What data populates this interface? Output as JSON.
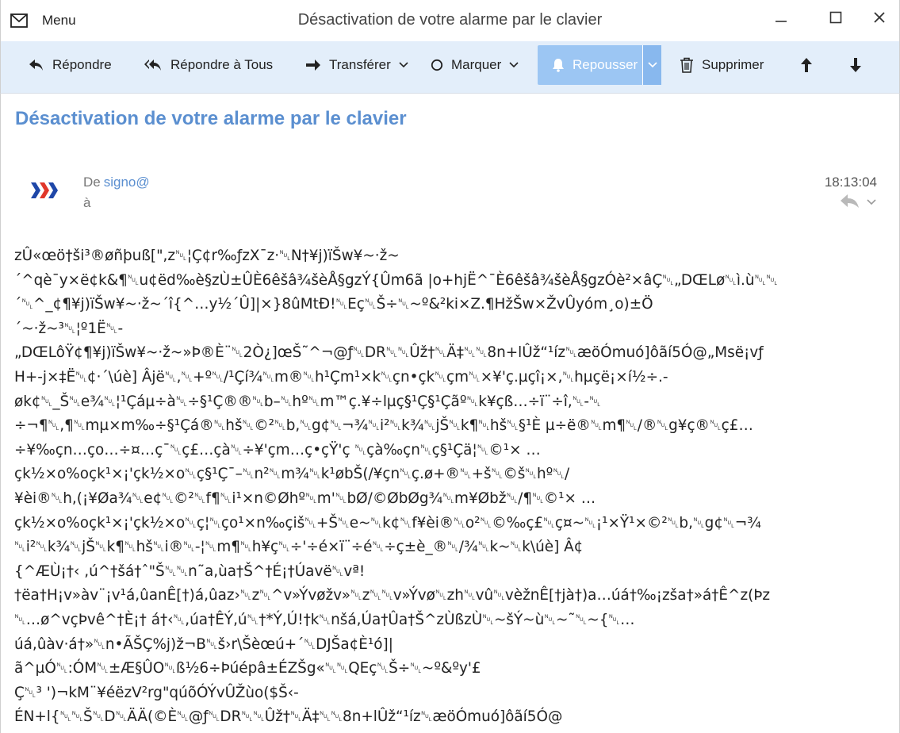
{
  "window": {
    "menu_label": "Menu",
    "title": "Désactivation de votre alarme par le clavier",
    "controls": [
      "minimize-icon",
      "maximize-icon",
      "close-icon"
    ]
  },
  "toolbar": {
    "reply": "Répondre",
    "reply_all": "Répondre à Tous",
    "forward": "Transférer",
    "mark": "Marquer",
    "snooze": "Repousser",
    "delete": "Supprimer",
    "accent": "#9cc6f3"
  },
  "message": {
    "subject": "Désactivation de votre alarme par le clavier",
    "from_label": "De",
    "from": "signo@",
    "to_label": "à",
    "time": "18:13:04",
    "subject_color": "#5b8fd0",
    "body_lines": [
      "zÛ«œö†ši³®øñþuß[\",z␀¦Ç¢r‰ƒzX¯z·␀N†¥j)ïŠw¥~·ž~",
      "´^qè¯y×ë¢k&¶␀u¢ëd‰è§zÙ±ÛÈ6êšâ¾šèÅ§gzÝ{Ûm6ã  |o+hjË^¯È6êšâ¾šèÅ§gzÓè²×âÇ␀„DŒLø␀ì.ù␀␀",
      "´␀^_¢¶¥j)ïŠw¥~·ž~´î{^…y½´Û]|×}8ûMtÐ!␀Eç␀Š÷␀~º&²ki×Z.¶HžŠw×ŽvÛyóm¸o)±Ö",
      "´~·ž~³␀¦º1Ë␀-",
      "„DŒLôŸ¢¶¥j)ïŠw¥~·ž~»Þ®È¨␀2Ò¿]œŠ˜^¬@ƒ␀DR␀␀Ûž†␀Ä‡␀␀8n+lÛž“¹íz␀æöÓmuó]ôãí5Ó@„Msë¡vƒ",
      "H+-j×‡Ë␀¢·´\\úè] Âjë␀,␀+º␀/¹Çí¾␀m®␀h¹Çm¹×k␀çn•çk␀çm␀×¥'ç.µçî¡×,␀hµçë¡×í½÷.-",
      "øk¢␀_Š␀e¾␀¦¹Çáµ÷à␀÷§¹Ç®®␀b–␀hº␀m™ç.¥÷lµç§¹Ç§¹Çãº␀k¥çß…÷ï¨÷î,␀-␀",
      "÷¬¶␀,¶␀mµ×m‰÷§¹Çá®␀hš␀©²␀b,␀g¢␀¬¾␀i²␀k¾␀jŠ␀k¶␀hš␀§¹È µ÷ë®␀m¶␀/®␀g¥ç®␀ç£…",
      "÷¥‰çn…ço…÷¤…ç¯␀ç£…çà␀÷¥'çm…ç•çŸ'ç ␀çà‰çn␀ç§¹Çä¦␀©¹× …",
      "çk½×o%oçk¹×¡'çk½×o␀ç§¹Ç¯–␀n²␀m¾␀k¹øbŠ(/¥çn␀ç.ø+®␀+š␀©š␀hº␀/",
      "¥èi®␀h,(¡¥Øa¾␀e¢␀©²␀f¶␀i¹×n©Øhº␀m'␀bØ/©ØbØg¾␀m¥Øbž␀/¶␀©¹× …",
      "çk½×o%oçk¹×¡'çk½×o␀ç¦␀ço¹×n‰çiš␀+Š␀e~␀k¢␀f¥èi®␀o²␀©‰ç£␀ç¤~␀¡¹×Ÿ¹×©²␀b,␀g¢␀¬¾",
      "␀i²␀k¾␀jŠ␀k¶␀hš␀i®␀-¦␀m¶␀h¥ç␀÷'÷é×ï¨÷é␀÷ç±è_®␀/¾␀k~␀k\\úè] Â¢",
      "{^ÆÙ¡†‹ ,ú^†šá†ˆ\"Š␀␀n˜a,ùa†Š^†É¡†Úavë␀vª!",
      "†ëa†H¡v»àv¨¡v¹á,ûanÊ[†)á,ûaz›␀z␀^v»Ývøžv»␀z␀␀v»Ývø␀zh␀vû␀vèžnÊ[†jà†)a…úá†‰¡zša†»á†Ê^z(Þz",
      "␀…ø^vçÞvê^†È¡†      á†‹␀,úa†ÊÝ,ú␀†*Ý,Ú!†k␀nšá,Úa†Ûa†Š^zÙßzÙ␀~šÝ~ù␀~˜␀~{␀…",
      "úá,ûàv·á†»␀n•ÃŠÇ%j)ž¬B␀š›r\\Šèœú+´␀DJŠa¢È¹ó]|",
      "ã^µÓ␀:ÓM␀±Æ§ÛO␀ß½6÷Þúépâ±ÉZŠg«␀␀QEç␀Š÷␀~º&ºy'£",
      "Ç␀³ ')¬kM¨¥éëzV²rg\"qúõÓÝvÛŽùo($Š‹-",
      "ÉN+l{␀␀Š␀D␀ÄÄ(©È␀@ƒ␀DR␀␀Ûž†␀Ä‡␀␀8n+lÛž“¹íz␀æöÓmuó]ôãí5Ó@"
    ]
  }
}
